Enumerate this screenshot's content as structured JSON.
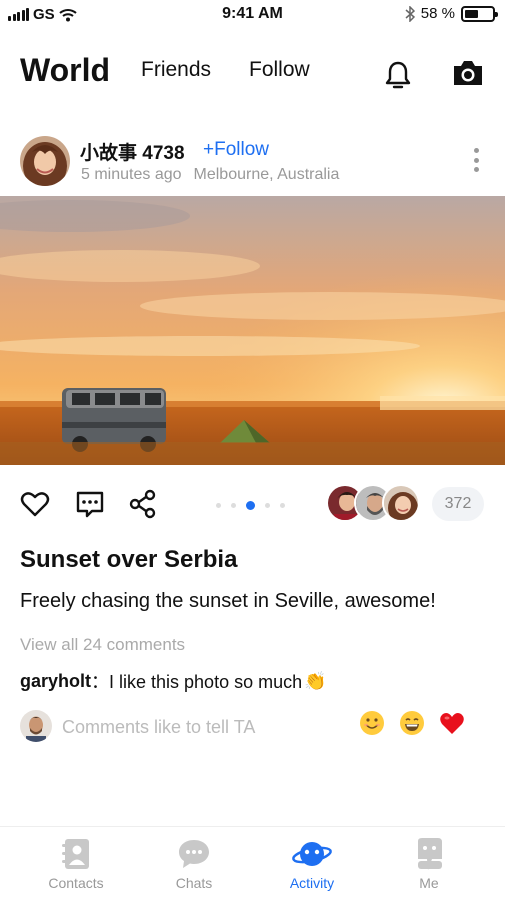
{
  "status": {
    "carrier": "GS",
    "time": "9:41 AM",
    "battery_text": "58 %",
    "battery_level": 0.58
  },
  "nav": {
    "tabs": [
      "World",
      "Friends",
      "Follow"
    ],
    "active": "World",
    "icons": [
      "bell-icon",
      "camera-icon"
    ]
  },
  "post": {
    "username": "小故事 4738",
    "follow_label": "+Follow",
    "time_ago": "5 minutes ago",
    "location": "Melbourne, Australia",
    "photo_pages": 5,
    "active_photo": 3,
    "like_count": "372",
    "title": "Sunset over Serbia",
    "description": "Freely chasing the sunset in Seville, awesome!",
    "view_comments": "View all 24 comments",
    "comment_user": "garyholt",
    "comment_text": "：I like this photo so much",
    "comment_input_placeholder": "Comments like to tell TA"
  },
  "quick_emojis": [
    "smile-emoji-icon",
    "grin-emoji-icon",
    "heart-emoji-icon"
  ],
  "tabbar": {
    "items": [
      {
        "label": "Contacts",
        "icon": "contacts-icon"
      },
      {
        "label": "Chats",
        "icon": "chat-bubble-icon"
      },
      {
        "label": "Activity",
        "icon": "planet-icon"
      },
      {
        "label": "Me",
        "icon": "profile-icon"
      }
    ],
    "active": "Activity"
  },
  "colors": {
    "accent": "#1e6ff1",
    "muted": "#999999",
    "heart": "#e8101c"
  }
}
